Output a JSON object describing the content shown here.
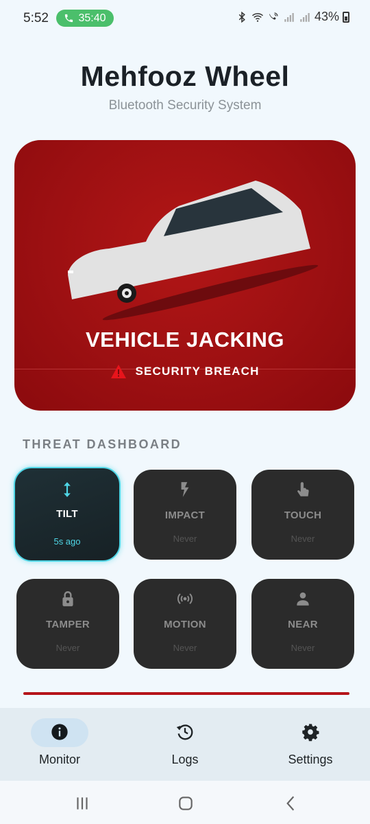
{
  "status_bar": {
    "time": "5:52",
    "call_timer": "35:40",
    "battery": "43%",
    "call_color": "#4bbf6b"
  },
  "header": {
    "title": "Mehfooz Wheel",
    "subtitle": "Bluetooth Security System"
  },
  "alert": {
    "title": "VEHICLE JACKING",
    "status": "SECURITY BREACH",
    "status_icon": "warning-triangle-icon",
    "background_color": "#a01214"
  },
  "dashboard": {
    "label": "THREAT DASHBOARD",
    "accent_color": "#4fd6e6",
    "tiles": [
      {
        "name": "TILT",
        "time": "5s ago",
        "icon": "vertical-arrows-icon",
        "active": true
      },
      {
        "name": "IMPACT",
        "time": "Never",
        "icon": "lightning-icon",
        "active": false
      },
      {
        "name": "TOUCH",
        "time": "Never",
        "icon": "touch-hand-icon",
        "active": false
      },
      {
        "name": "TAMPER",
        "time": "Never",
        "icon": "lock-icon",
        "active": false
      },
      {
        "name": "MOTION",
        "time": "Never",
        "icon": "motion-sensor-icon",
        "active": false
      },
      {
        "name": "NEAR",
        "time": "Never",
        "icon": "person-icon",
        "active": false
      }
    ]
  },
  "bottom_nav": {
    "items": [
      {
        "label": "Monitor",
        "icon": "info-icon",
        "selected": true
      },
      {
        "label": "Logs",
        "icon": "history-icon",
        "selected": false
      },
      {
        "label": "Settings",
        "icon": "gear-icon",
        "selected": false
      }
    ]
  }
}
